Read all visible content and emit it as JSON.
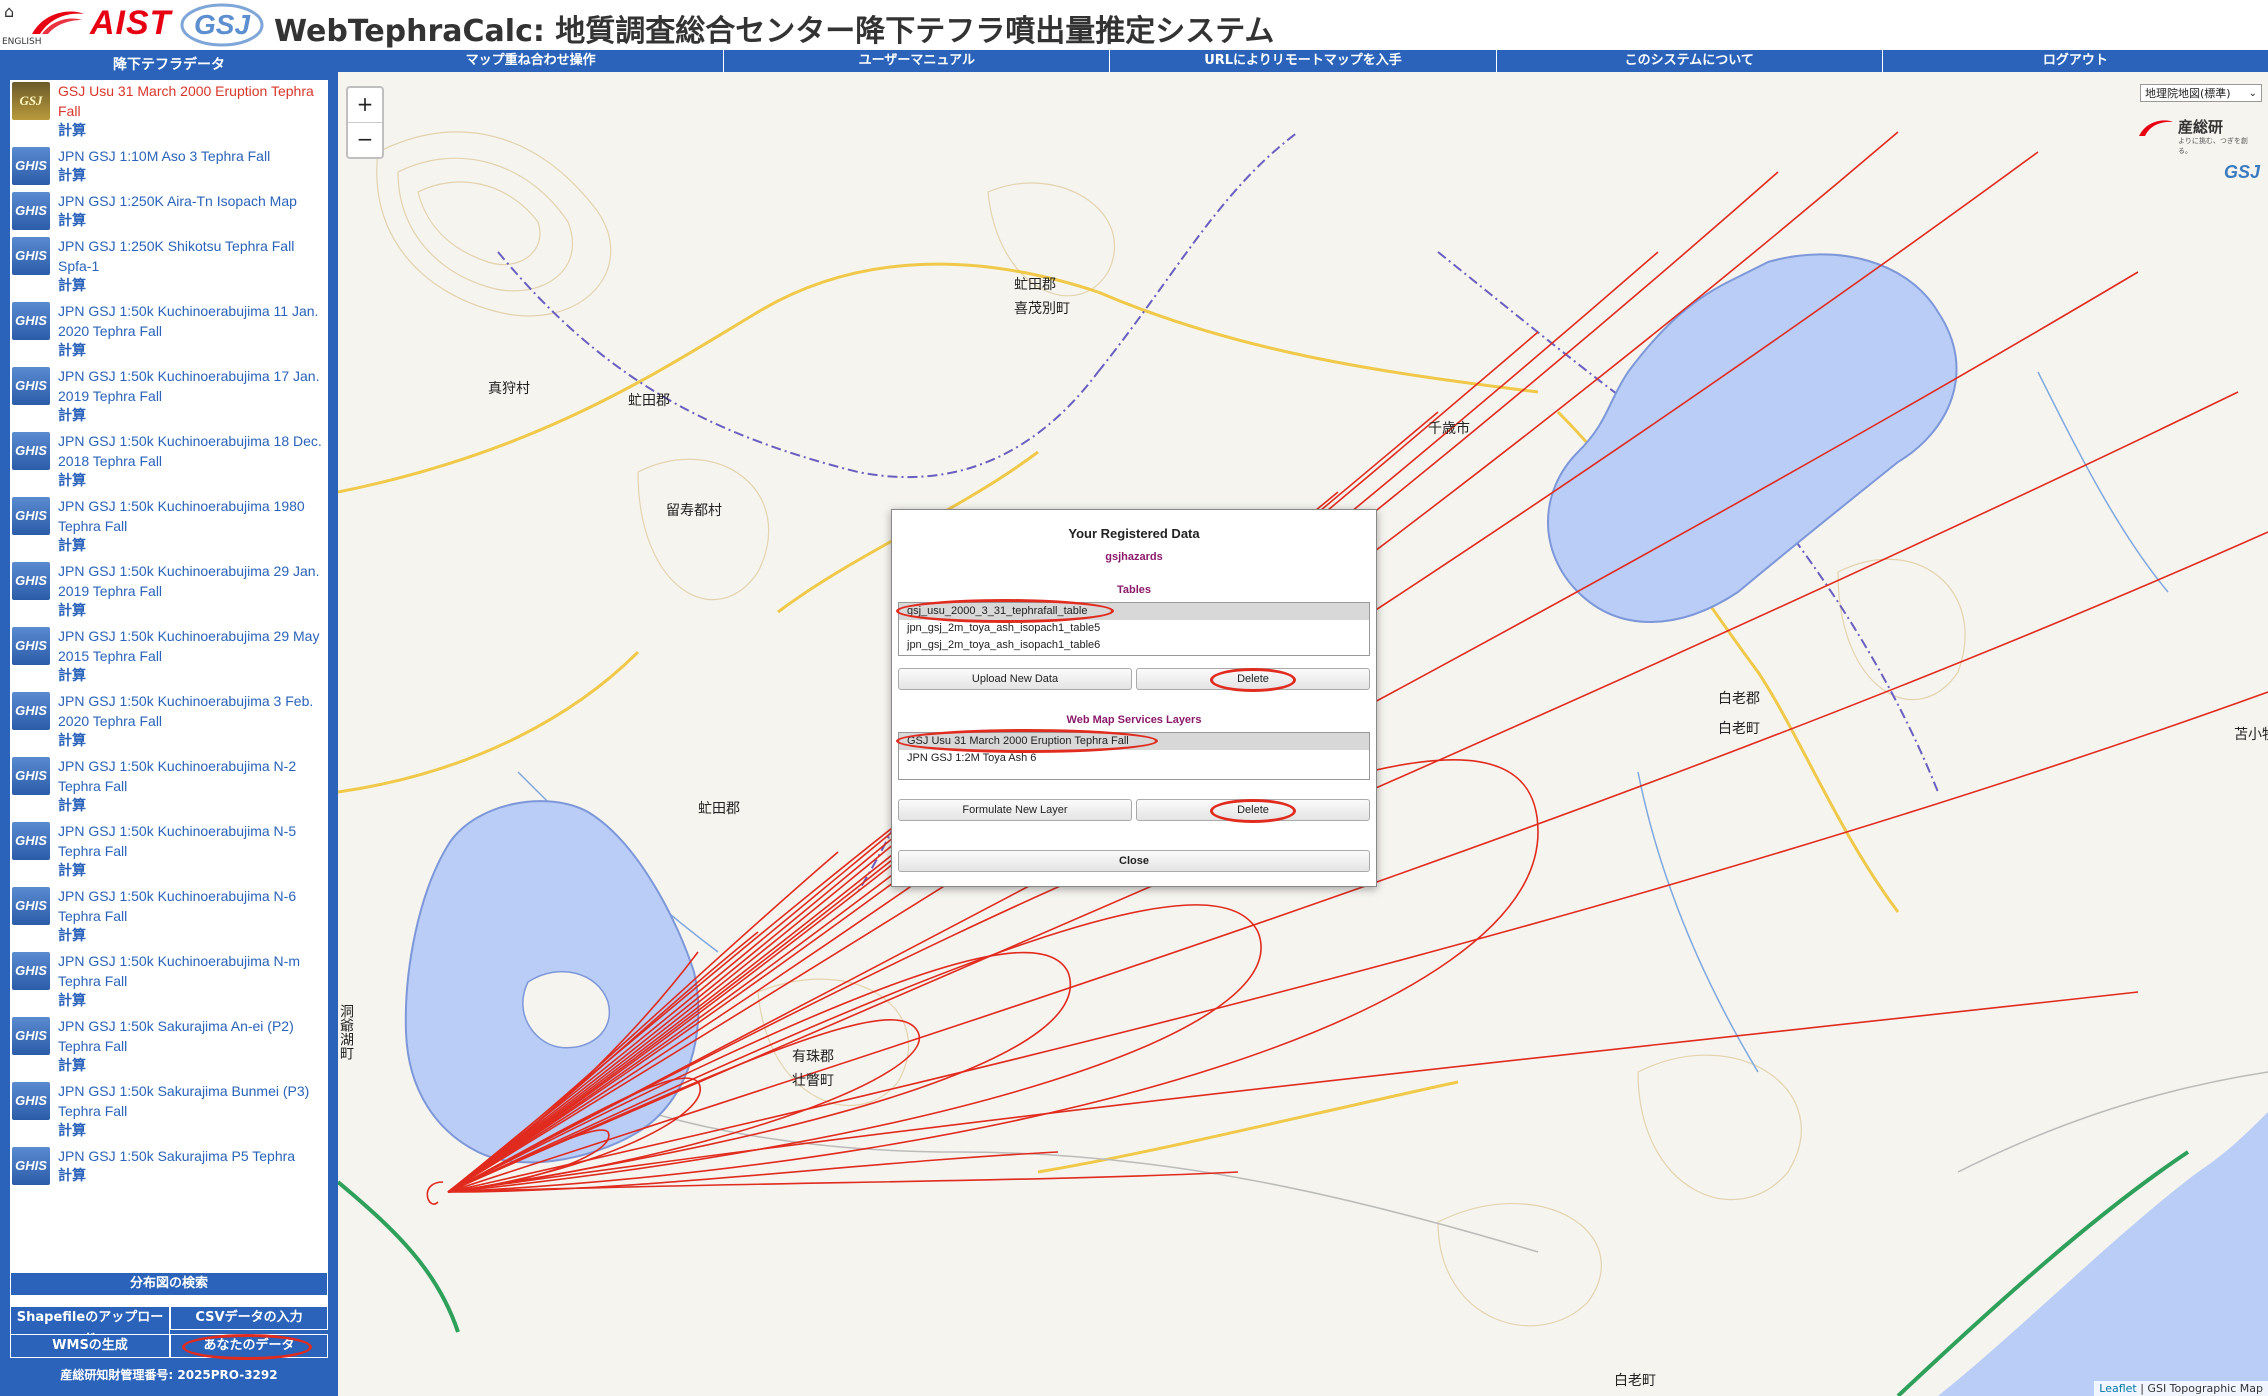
{
  "header": {
    "home_icon": "home-icon",
    "english": "ENGLISH",
    "aist_logo": "AIST",
    "gsj_logo": "GSJ",
    "title": "WebTephraCalc: 地質調査総合センター降下テフラ噴出量推定システム"
  },
  "sidebar": {
    "title": "降下テフラデータ",
    "calc_label": "計算",
    "datasets": [
      {
        "icon": "GSJ",
        "name": "GSJ Usu 31 March 2000 Eruption Tephra Fall",
        "active": true
      },
      {
        "icon": "GHIS",
        "name": "JPN GSJ 1:10M Aso 3 Tephra Fall"
      },
      {
        "icon": "GHIS",
        "name": "JPN GSJ 1:250K Aira-Tn Isopach Map"
      },
      {
        "icon": "GHIS",
        "name": "JPN GSJ 1:250K Shikotsu Tephra Fall Spfa-1"
      },
      {
        "icon": "GHIS",
        "name": "JPN GSJ 1:50k Kuchinoerabujima 11 Jan. 2020 Tephra Fall"
      },
      {
        "icon": "GHIS",
        "name": "JPN GSJ 1:50k Kuchinoerabujima 17 Jan. 2019 Tephra Fall"
      },
      {
        "icon": "GHIS",
        "name": "JPN GSJ 1:50k Kuchinoerabujima 18 Dec. 2018 Tephra Fall"
      },
      {
        "icon": "GHIS",
        "name": "JPN GSJ 1:50k Kuchinoerabujima 1980 Tephra Fall"
      },
      {
        "icon": "GHIS",
        "name": "JPN GSJ 1:50k Kuchinoerabujima 29 Jan. 2019 Tephra Fall"
      },
      {
        "icon": "GHIS",
        "name": "JPN GSJ 1:50k Kuchinoerabujima 29 May 2015 Tephra Fall"
      },
      {
        "icon": "GHIS",
        "name": "JPN GSJ 1:50k Kuchinoerabujima 3 Feb. 2020 Tephra Fall"
      },
      {
        "icon": "GHIS",
        "name": "JPN GSJ 1:50k Kuchinoerabujima N-2 Tephra Fall"
      },
      {
        "icon": "GHIS",
        "name": "JPN GSJ 1:50k Kuchinoerabujima N-5 Tephra Fall"
      },
      {
        "icon": "GHIS",
        "name": "JPN GSJ 1:50k Kuchinoerabujima N-6 Tephra Fall"
      },
      {
        "icon": "GHIS",
        "name": "JPN GSJ 1:50k Kuchinoerabujima N-m Tephra Fall"
      },
      {
        "icon": "GHIS",
        "name": "JPN GSJ 1:50k Sakurajima An-ei (P2) Tephra Fall"
      },
      {
        "icon": "GHIS",
        "name": "JPN GSJ 1:50k Sakurajima Bunmei (P3) Tephra Fall"
      },
      {
        "icon": "GHIS",
        "name": "JPN GSJ 1:50k Sakurajima P5 Tephra"
      }
    ],
    "search_btn": "分布図の検索",
    "shapefile_btn": "Shapefileのアップロード",
    "csv_btn": "CSVデータの入力",
    "wms_btn": "WMSの生成",
    "your_data_btn": "あなたのデータ",
    "footer": "産総研知財管理番号: 2025PRO-3292"
  },
  "nav": {
    "items": [
      "マップ重ね合わせ操作",
      "ユーザーマニュアル",
      "URLによりリモートマップを入手",
      "このシステムについて",
      "ログアウト"
    ]
  },
  "map": {
    "basemap_select": "地理院地図(標準)",
    "zoom_in": "+",
    "zoom_out": "−",
    "aist_corner": "産総研",
    "aist_tagline": "よりに挑む、つぎを創る。",
    "gsj_corner": "GSJ",
    "attribution_leaflet": "Leaflet",
    "attribution_rest": " | GSI Topographic Map",
    "labels": {
      "makkari": "真狩村",
      "abuta_gun1": "虻田郡",
      "kimobetsu": "喜茂別町",
      "abuta_gun2": "虻田郡",
      "rusutsu": "留寿都村",
      "chitose": "千歳市",
      "abuta_gun3": "虻田郡",
      "shiraoi_gun": "白老郡",
      "shiraoi_town": "白老町",
      "usu_gun": "有珠郡",
      "sobetsu": "壮瞥町",
      "toyako": "洞爺湖町",
      "shiraoi_bottom": "白老町",
      "tomakomai": "苫小牧"
    },
    "colors": {
      "lake": "#b9cdf7",
      "lake_edge": "#7d97d8",
      "isopach": "#e02b1e",
      "sidebar": "#2a63b9"
    }
  },
  "modal": {
    "title": "Your Registered Data",
    "user": "gsjhazards",
    "tables_label": "Tables",
    "tables": [
      "gsj_usu_2000_3_31_tephrafall_table",
      "jpn_gsj_2m_toya_ash_isopach1_table5",
      "jpn_gsj_2m_toya_ash_isopach1_table6"
    ],
    "upload_btn": "Upload New Data",
    "delete_btn": "Delete",
    "wms_label": "Web Map Services Layers",
    "layers": [
      "GSJ Usu 31 March 2000 Eruption Tephra Fall",
      "JPN GSJ 1:2M Toya Ash 6"
    ],
    "formulate_btn": "Formulate New Layer",
    "delete_btn2": "Delete",
    "close_btn": "Close"
  }
}
